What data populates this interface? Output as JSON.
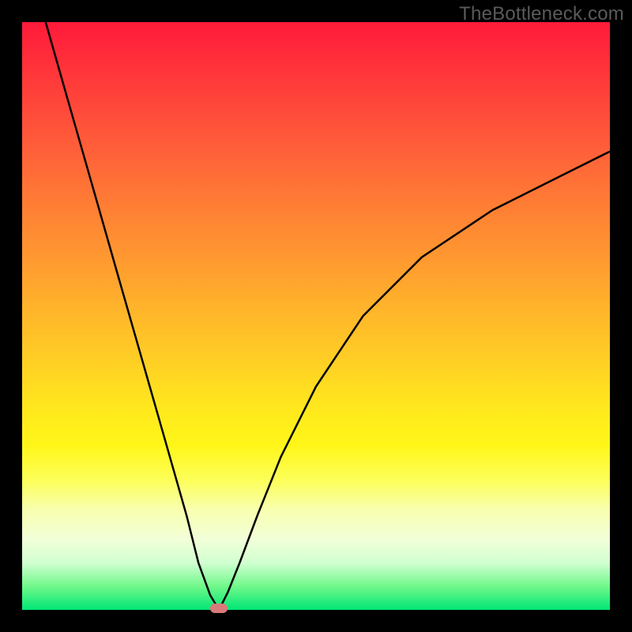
{
  "watermark": "TheBottleneck.com",
  "chart_data": {
    "type": "line",
    "title": "",
    "xlabel": "",
    "ylabel": "",
    "xlim": [
      0,
      100
    ],
    "ylim": [
      0,
      100
    ],
    "grid": false,
    "series": [
      {
        "name": "left-branch",
        "x": [
          4,
          8,
          12,
          16,
          20,
          24,
          28,
          30,
          32,
          33.5
        ],
        "y": [
          100,
          86,
          72,
          58,
          44,
          30,
          16,
          8,
          2.5,
          0
        ]
      },
      {
        "name": "right-branch",
        "x": [
          33.5,
          35,
          37,
          40,
          44,
          50,
          58,
          68,
          80,
          92,
          100
        ],
        "y": [
          0,
          3,
          8,
          16,
          26,
          38,
          50,
          60,
          68,
          74,
          78
        ]
      }
    ],
    "marker": {
      "x": 33.5,
      "y": 0
    },
    "background_gradient_top": "#ff1a3a",
    "background_gradient_bottom": "#00e676"
  }
}
